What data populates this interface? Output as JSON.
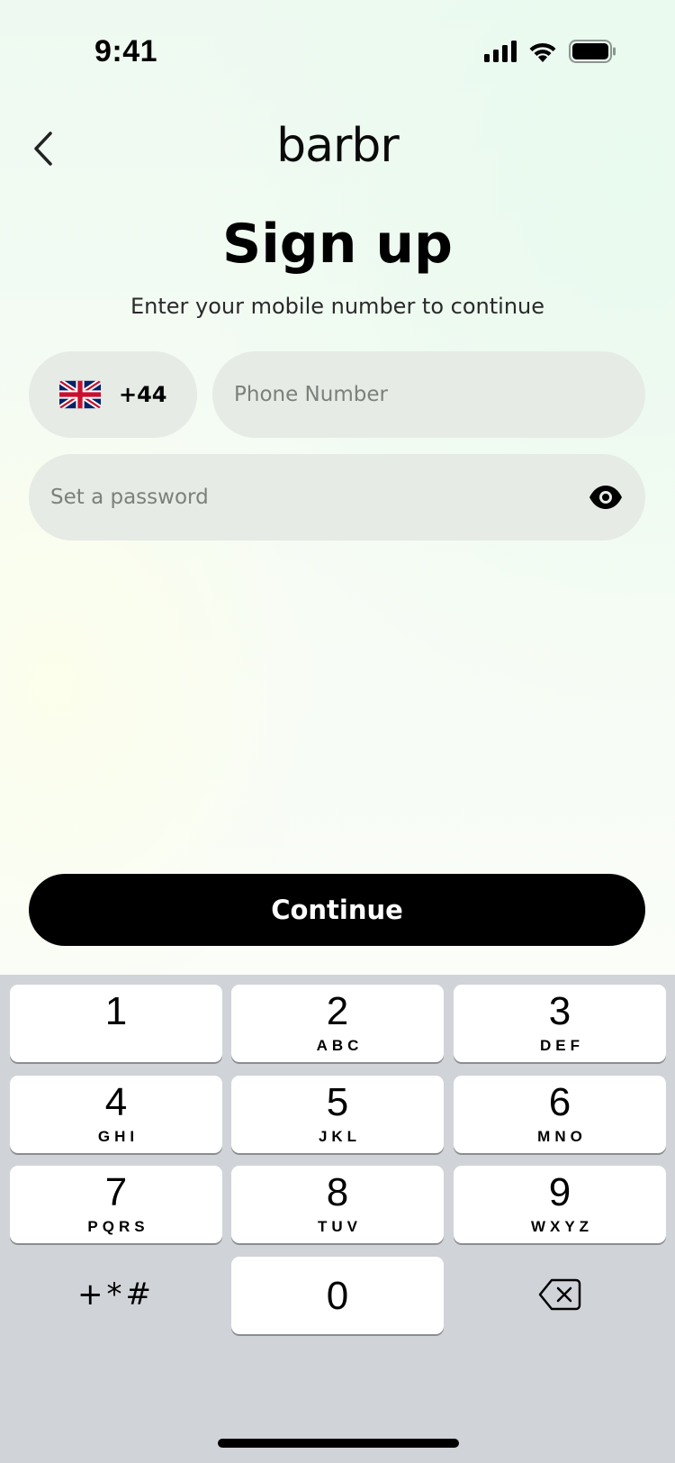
{
  "status_bar": {
    "time": "9:41"
  },
  "header": {
    "logo": "barbr",
    "title": "Sign up",
    "subtitle": "Enter your mobile number to continue"
  },
  "form": {
    "country_code": "+44",
    "country_flag": "uk-flag-icon",
    "phone_placeholder": "Phone Number",
    "password_placeholder": "Set a password"
  },
  "continue_label": "Continue",
  "keyboard": {
    "keys": [
      {
        "digit": "1",
        "letters": ""
      },
      {
        "digit": "2",
        "letters": "ABC"
      },
      {
        "digit": "3",
        "letters": "DEF"
      },
      {
        "digit": "4",
        "letters": "GHI"
      },
      {
        "digit": "5",
        "letters": "JKL"
      },
      {
        "digit": "6",
        "letters": "MNO"
      },
      {
        "digit": "7",
        "letters": "PQRS"
      },
      {
        "digit": "8",
        "letters": "TUV"
      },
      {
        "digit": "9",
        "letters": "WXYZ"
      },
      {
        "digit": "0",
        "letters": ""
      }
    ],
    "symbols": "+*#"
  },
  "colors": {
    "primary": "#000000",
    "field_bg": "#e6ebe5",
    "keyboard_bg": "#d0d4d9"
  }
}
